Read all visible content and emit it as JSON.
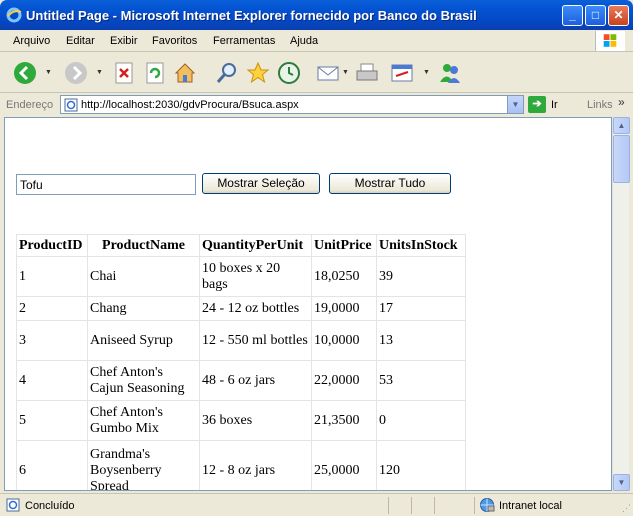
{
  "window": {
    "title": "Untitled Page - Microsoft Internet Explorer fornecido por Banco do Brasil",
    "buttons": {
      "minimize": "_",
      "maximize": "□",
      "close": "✕"
    }
  },
  "menu": [
    "Arquivo",
    "Editar",
    "Exibir",
    "Favoritos",
    "Ferramentas",
    "Ajuda"
  ],
  "toolbar": {
    "icons": [
      "back-icon",
      "forward-icon",
      "stop-icon",
      "refresh-icon",
      "home-icon",
      "search-icon",
      "favorites-icon",
      "history-icon",
      "mail-icon",
      "print-icon",
      "edit-icon",
      "messenger-icon"
    ]
  },
  "address": {
    "label": "Endereço",
    "url": "http://localhost:2030/gdvProcura/Bsuca.aspx",
    "go_label": "Ir",
    "links_label": "Links",
    "links_chevron": "»"
  },
  "form": {
    "search_value": "Tofu",
    "show_selection_label": "Mostrar Seleção",
    "show_all_label": "Mostrar Tudo"
  },
  "grid": {
    "headers": [
      "ProductID",
      "ProductName",
      "QuantityPerUnit",
      "UnitPrice",
      "UnitsInStock"
    ],
    "rows": [
      [
        "1",
        "Chai",
        "10 boxes x 20 bags",
        "18,0250",
        "39"
      ],
      [
        "2",
        "Chang",
        "24 - 12 oz bottles",
        "19,0000",
        "17"
      ],
      [
        "3",
        "Aniseed Syrup",
        "12 - 550 ml bottles",
        "10,0000",
        "13"
      ],
      [
        "4",
        "Chef Anton's Cajun Seasoning",
        "48 - 6 oz jars",
        "22,0000",
        "53"
      ],
      [
        "5",
        "Chef Anton's Gumbo Mix",
        "36 boxes",
        "21,3500",
        "0"
      ],
      [
        "6",
        "Grandma's Boysenberry Spread",
        "12 - 8 oz jars",
        "25,0000",
        "120"
      ]
    ]
  },
  "status": {
    "text": "Concluído",
    "zone": "Intranet local"
  }
}
